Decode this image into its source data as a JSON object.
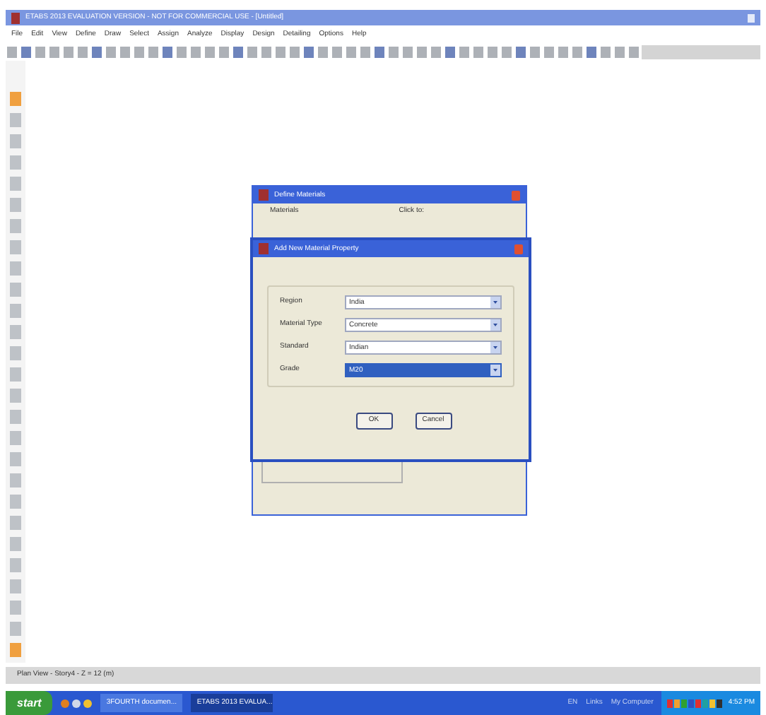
{
  "window": {
    "title": "ETABS 2013 EVALUATION VERSION - NOT FOR COMMERCIAL USE - [Untitled]"
  },
  "menu": [
    "File",
    "Edit",
    "View",
    "Define",
    "Draw",
    "Select",
    "Assign",
    "Analyze",
    "Display",
    "Design",
    "Detailing",
    "Options",
    "Help"
  ],
  "back_dialog": {
    "title": "Define Materials",
    "materials_label": "Materials",
    "click_label": "Click to:"
  },
  "dialog": {
    "title": "Add New Material Property",
    "fields": [
      {
        "label": "Region",
        "value": "India",
        "selected": false
      },
      {
        "label": "Material Type",
        "value": "Concrete",
        "selected": false
      },
      {
        "label": "Standard",
        "value": "Indian",
        "selected": false
      },
      {
        "label": "Grade",
        "value": "M20",
        "selected": true
      }
    ],
    "buttons": [
      "OK",
      "Cancel"
    ]
  },
  "status_bar": "Plan View - Story4 - Z = 12 (m)",
  "taskbar": {
    "start": "start",
    "tasks": [
      {
        "label": "3FOURTH documen...",
        "selected": false
      },
      {
        "label": "ETABS 2013 EVALUA...",
        "selected": true
      }
    ],
    "tray": [
      "EN",
      "Links",
      "My Computer"
    ],
    "clock": "4:52 PM"
  }
}
